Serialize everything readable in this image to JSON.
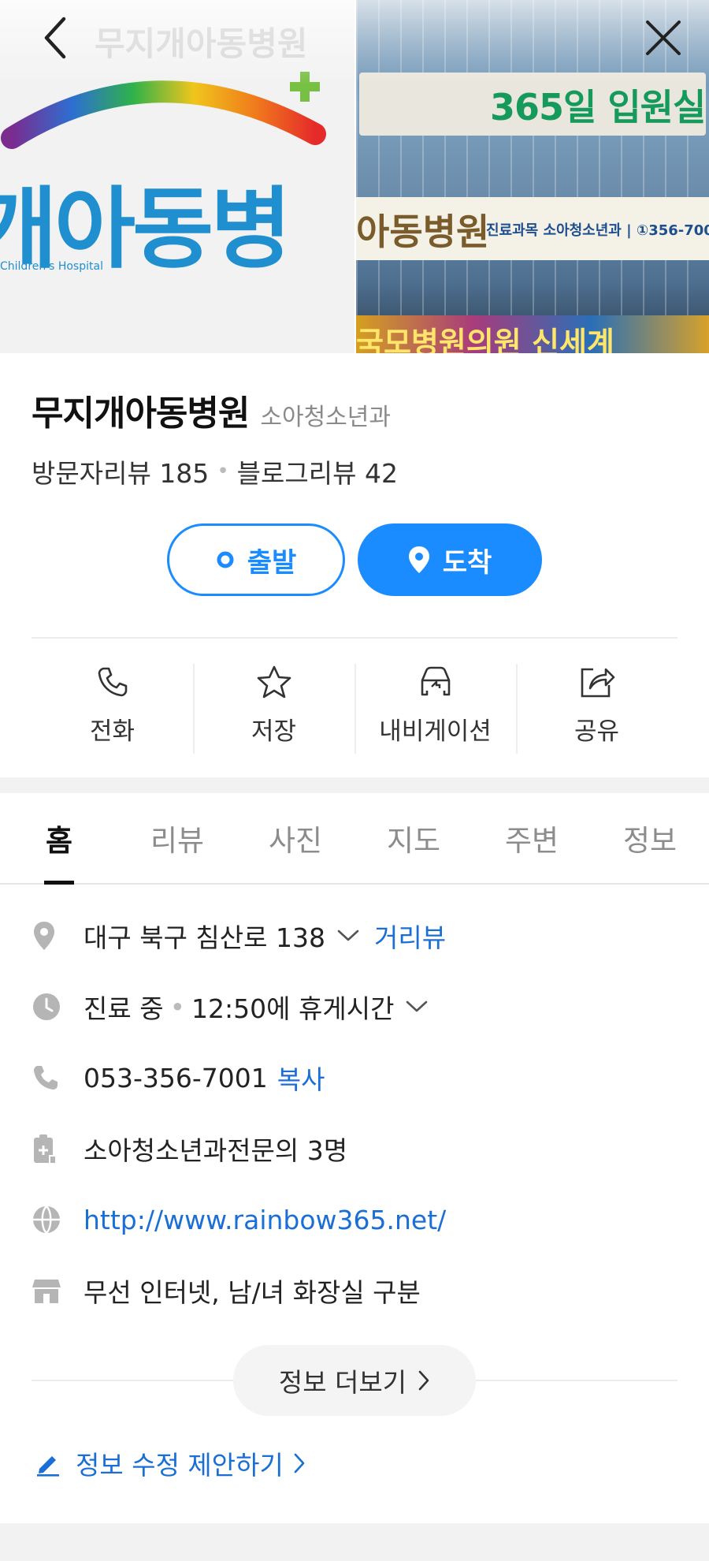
{
  "header": {
    "ghost_title": "무지개아동병원",
    "back_icon": "chevron-left-icon",
    "close_icon": "close-icon"
  },
  "photos": {
    "left_logo_text": "개아동병",
    "left_logo_sub": "Children's Hospital",
    "right_sign_top": "365일 입원실",
    "right_sign_mid": "아동병원",
    "right_sign_mid_sub": "진료과목 소아청소년과 | ①356-700",
    "right_sign_bottom": "국모병원의원 신세계"
  },
  "place": {
    "name": "무지개아동병원",
    "category": "소아청소년과",
    "visitor_reviews_label": "방문자리뷰",
    "visitor_reviews_count": "185",
    "blog_reviews_label": "블로그리뷰",
    "blog_reviews_count": "42"
  },
  "route": {
    "depart_label": "출발",
    "arrive_label": "도착"
  },
  "actions": [
    {
      "label": "전화",
      "icon": "phone-icon"
    },
    {
      "label": "저장",
      "icon": "star-icon"
    },
    {
      "label": "내비게이션",
      "icon": "car-navigation-icon"
    },
    {
      "label": "공유",
      "icon": "share-icon"
    }
  ],
  "tabs": [
    {
      "label": "홈",
      "active": true
    },
    {
      "label": "리뷰"
    },
    {
      "label": "사진"
    },
    {
      "label": "지도"
    },
    {
      "label": "주변"
    },
    {
      "label": "정보"
    }
  ],
  "info": {
    "address": "대구 북구 침산로 138",
    "street_view": "거리뷰",
    "status": "진료 중",
    "hours_note": "12:50에 휴게시간",
    "phone": "053-356-7001",
    "copy": "복사",
    "doctors": "소아청소년과전문의 3명",
    "website": "http://www.rainbow365.net/",
    "amenities": "무선 인터넷, 남/녀 화장실 구분"
  },
  "more": {
    "label": "정보 더보기"
  },
  "suggest": {
    "label": "정보 수정 제안하기"
  },
  "colors": {
    "accent": "#1a8cff",
    "link": "#1a6fd6",
    "muted": "#8c8c8c"
  }
}
